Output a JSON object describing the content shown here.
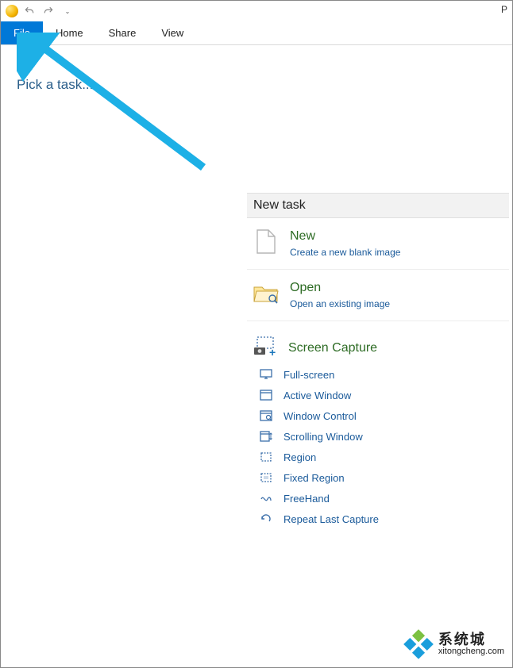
{
  "qat": {
    "right_char": "P"
  },
  "tabs": {
    "file": "File",
    "home": "Home",
    "share": "Share",
    "view": "View"
  },
  "pick_task": "Pick a task...",
  "panel": {
    "header": "New task",
    "new": {
      "title": "New",
      "sub": "Create a new blank image"
    },
    "open": {
      "title": "Open",
      "sub": "Open an existing image"
    },
    "screen_capture": {
      "title": "Screen Capture",
      "items": {
        "full_screen": "Full-screen",
        "active_window": "Active Window",
        "window_control": "Window Control",
        "scrolling_window": "Scrolling Window",
        "region": "Region",
        "fixed_region": "Fixed Region",
        "freehand": "FreeHand",
        "repeat_last": "Repeat Last Capture"
      }
    }
  },
  "watermark": {
    "cn": "系统城",
    "url": "xitongcheng.com"
  }
}
